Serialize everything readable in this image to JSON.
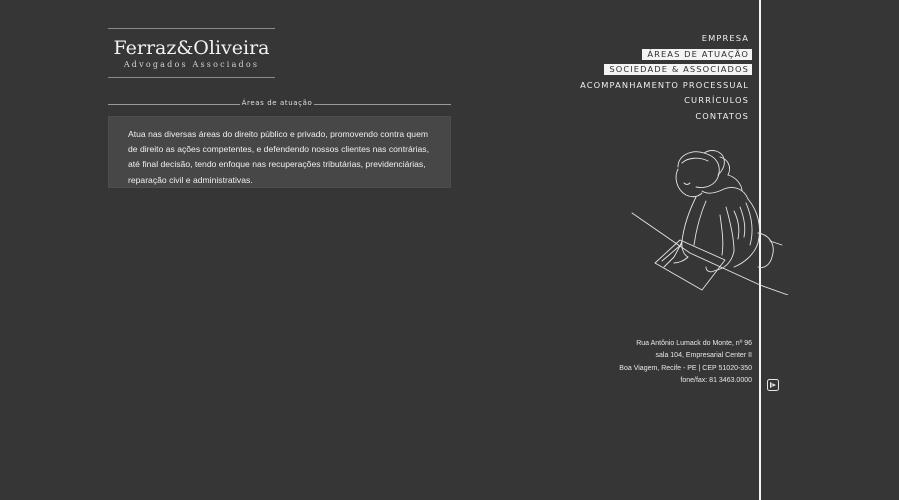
{
  "logo": {
    "name": "Ferraz&Oliveira",
    "tagline": "Advogados Associados"
  },
  "section": {
    "title": "Áreas de atuação",
    "body": "Atua nas diversas áreas do direito público e privado, promovendo contra quem de direito as ações competentes, e defendendo nossos clientes nas contrárias, até final decisão, tendo enfoque nas recuperações tributárias, previdenciárias, reparação civil e administrativas."
  },
  "nav": {
    "items": [
      {
        "label": "EMPRESA",
        "active": false
      },
      {
        "label": "ÁREAS DE ATUAÇÃO",
        "active": true
      },
      {
        "label": "SOCIEDADE & ASSOCIADOS",
        "active": true
      },
      {
        "label": "ACOMPANHAMENTO PROCESSUAL",
        "active": false
      },
      {
        "label": "CURRÍCULOS",
        "active": false
      },
      {
        "label": "CONTATOS",
        "active": false
      }
    ]
  },
  "address": {
    "line1": "Rua Antônio Lumack do Monte, nº 96",
    "line2": "sala 104, Empresarial Center II",
    "line3": "Boa Viagem, Recife - PE | CEP 51020-350",
    "line4": "fone/fax: 81 3463.0000"
  },
  "icons": {
    "illustration": "woman-writing-illustration",
    "badge": "developer-badge-icon"
  },
  "colors": {
    "background": "#363636",
    "box": "#474747",
    "highlight": "#f4f4f4"
  }
}
